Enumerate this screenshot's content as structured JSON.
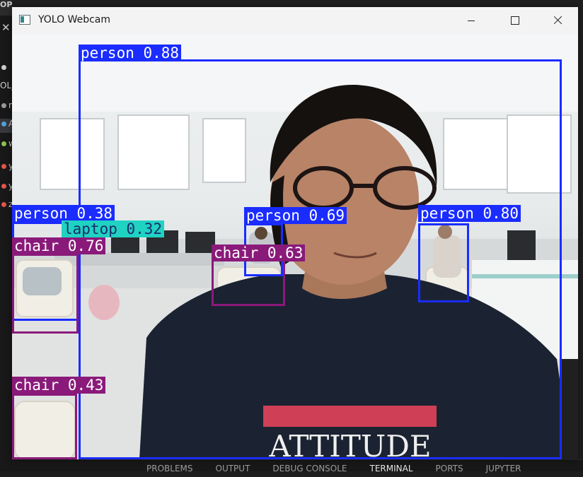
{
  "window": {
    "title": "YOLO Webcam",
    "controls": [
      "minimize",
      "maximize",
      "close"
    ]
  },
  "ide_background": {
    "sidebar_header": "OPEN EDITORS",
    "sidebar_letters": [
      "OL_",
      "r",
      "A",
      "w",
      "y",
      "y",
      "z"
    ],
    "panel_tabs": [
      "PROBLEMS",
      "OUTPUT",
      "DEBUG CONSOLE",
      "TERMINAL",
      "PORTS",
      "JUPYTER"
    ],
    "active_panel_tab": "TERMINAL"
  },
  "detections": [
    {
      "label": "person 0.88",
      "color": "#1a2cff"
    },
    {
      "label": "person 0.38",
      "color": "#1a2cff"
    },
    {
      "label": "laptop 0.32",
      "color": "#1fd2c2"
    },
    {
      "label": "chair 0.76",
      "color": "#8a1a7a"
    },
    {
      "label": "person 0.69",
      "color": "#1a2cff"
    },
    {
      "label": "person 0.80",
      "color": "#1a2cff"
    },
    {
      "label": "chair 0.63",
      "color": "#8a1a7a"
    },
    {
      "label": "chair 0.43",
      "color": "#8a1a7a"
    }
  ],
  "shirt_text": "ATTITUDE"
}
